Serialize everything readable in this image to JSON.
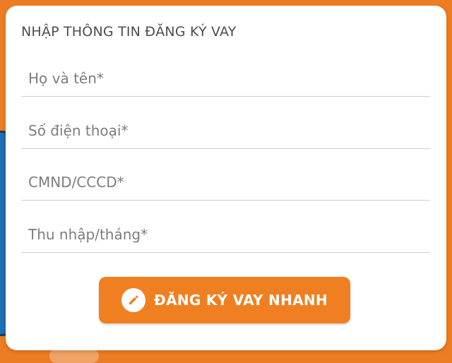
{
  "form": {
    "title": "NHẬP THÔNG TIN ĐĂNG KÝ VAY",
    "fields": [
      {
        "placeholder": "Họ và tên*",
        "value": ""
      },
      {
        "placeholder": "Số điện thoại*",
        "value": ""
      },
      {
        "placeholder": "CMND/CCCD*",
        "value": ""
      },
      {
        "placeholder": "Thu nhập/tháng*",
        "value": ""
      }
    ],
    "submit_label": "ĐĂNG KÝ VAY NHANH",
    "submit_icon": "pencil-icon"
  },
  "colors": {
    "accent": "#f07f21",
    "background": "#ec7d24",
    "card": "#ffffff",
    "text": "#4d4d4d",
    "divider": "#cfcfcf"
  }
}
